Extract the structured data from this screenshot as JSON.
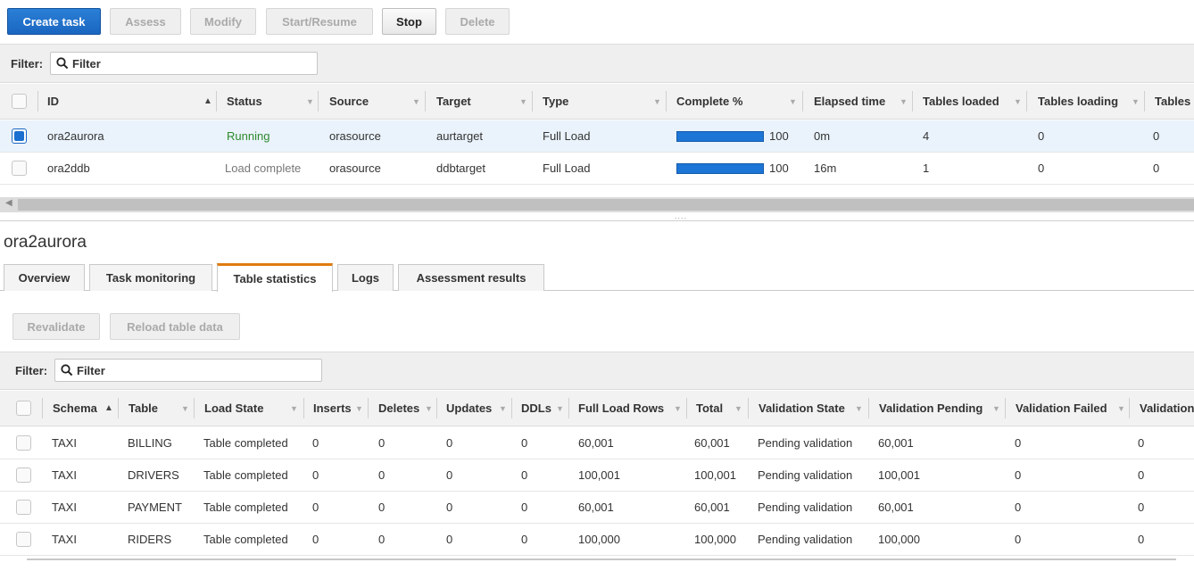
{
  "toolbar": {
    "create_task": "Create task",
    "assess": "Assess",
    "modify": "Modify",
    "start_resume": "Start/Resume",
    "stop": "Stop",
    "delete": "Delete"
  },
  "tasks_filter": {
    "label": "Filter:",
    "placeholder": "Filter"
  },
  "tasks_table": {
    "headers": [
      "ID",
      "Status",
      "Source",
      "Target",
      "Type",
      "Complete %",
      "Elapsed time",
      "Tables loaded",
      "Tables loading",
      "Tables"
    ],
    "rows": [
      {
        "id": "ora2aurora",
        "status": "Running",
        "source": "orasource",
        "target": "aurtarget",
        "type": "Full Load",
        "complete": "100",
        "complete_fraction": 1.0,
        "elapsed": "0m",
        "loaded": "4",
        "loading": "0",
        "tables": "0",
        "selected": true
      },
      {
        "id": "ora2ddb",
        "status": "Load complete",
        "source": "orasource",
        "target": "ddbtarget",
        "type": "Full Load",
        "complete": "100",
        "complete_fraction": 1.0,
        "elapsed": "16m",
        "loaded": "1",
        "loading": "0",
        "tables": "0",
        "selected": false
      }
    ]
  },
  "detail": {
    "title": "ora2aurora",
    "tabs": [
      "Overview",
      "Task monitoring",
      "Table statistics",
      "Logs",
      "Assessment results"
    ],
    "active_tab": "Table statistics",
    "revalidate": "Revalidate",
    "reload": "Reload table data"
  },
  "stats_filter": {
    "label": "Filter:",
    "placeholder": "Filter"
  },
  "stats_table": {
    "headers": [
      "Schema",
      "Table",
      "Load State",
      "Inserts",
      "Deletes",
      "Updates",
      "DDLs",
      "Full Load Rows",
      "Total",
      "Validation State",
      "Validation Pending",
      "Validation Failed",
      "Validation"
    ],
    "rows": [
      {
        "schema": "TAXI",
        "table": "BILLING",
        "load_state": "Table completed",
        "inserts": "0",
        "deletes": "0",
        "updates": "0",
        "ddls": "0",
        "full_load_rows": "60,001",
        "total": "60,001",
        "val_state": "Pending validation",
        "val_pending": "60,001",
        "val_failed": "0",
        "validation": "0"
      },
      {
        "schema": "TAXI",
        "table": "DRIVERS",
        "load_state": "Table completed",
        "inserts": "0",
        "deletes": "0",
        "updates": "0",
        "ddls": "0",
        "full_load_rows": "100,001",
        "total": "100,001",
        "val_state": "Pending validation",
        "val_pending": "100,001",
        "val_failed": "0",
        "validation": "0"
      },
      {
        "schema": "TAXI",
        "table": "PAYMENT",
        "load_state": "Table completed",
        "inserts": "0",
        "deletes": "0",
        "updates": "0",
        "ddls": "0",
        "full_load_rows": "60,001",
        "total": "60,001",
        "val_state": "Pending validation",
        "val_pending": "60,001",
        "val_failed": "0",
        "validation": "0"
      },
      {
        "schema": "TAXI",
        "table": "RIDERS",
        "load_state": "Table completed",
        "inserts": "0",
        "deletes": "0",
        "updates": "0",
        "ddls": "0",
        "full_load_rows": "100,000",
        "total": "100,000",
        "val_state": "Pending validation",
        "val_pending": "100,000",
        "val_failed": "0",
        "validation": "0"
      }
    ]
  },
  "colors": {
    "primary": "#1a66c0",
    "running": "#2d8a2d",
    "progress": "#1d75d6",
    "active_tab": "#e07b10"
  }
}
